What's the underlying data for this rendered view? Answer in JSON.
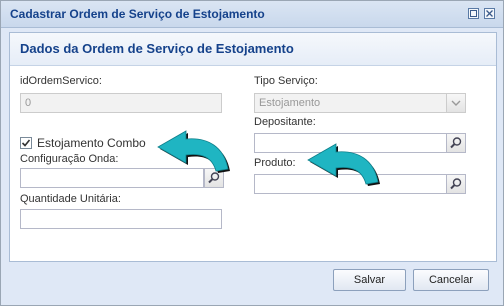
{
  "window": {
    "title": "Cadastrar Ordem de Serviço de Estojamento"
  },
  "panel": {
    "header": "Dados da Ordem de Serviço de Estojamento"
  },
  "form": {
    "id_label": "idOrdemServico:",
    "id_value": "0",
    "tipo_label": "Tipo Serviço:",
    "tipo_value": "Estojamento",
    "depositante_label": "Depositante:",
    "combo_label": "Estojamento Combo",
    "combo_checked": true,
    "config_onda_label": "Configuração Onda:",
    "produto_label": "Produto:",
    "quantidade_label": "Quantidade Unitária:"
  },
  "buttons": {
    "save": "Salvar",
    "cancel": "Cancelar"
  },
  "colors": {
    "arrow": "#1fb5c2",
    "header_text": "#15428b"
  }
}
